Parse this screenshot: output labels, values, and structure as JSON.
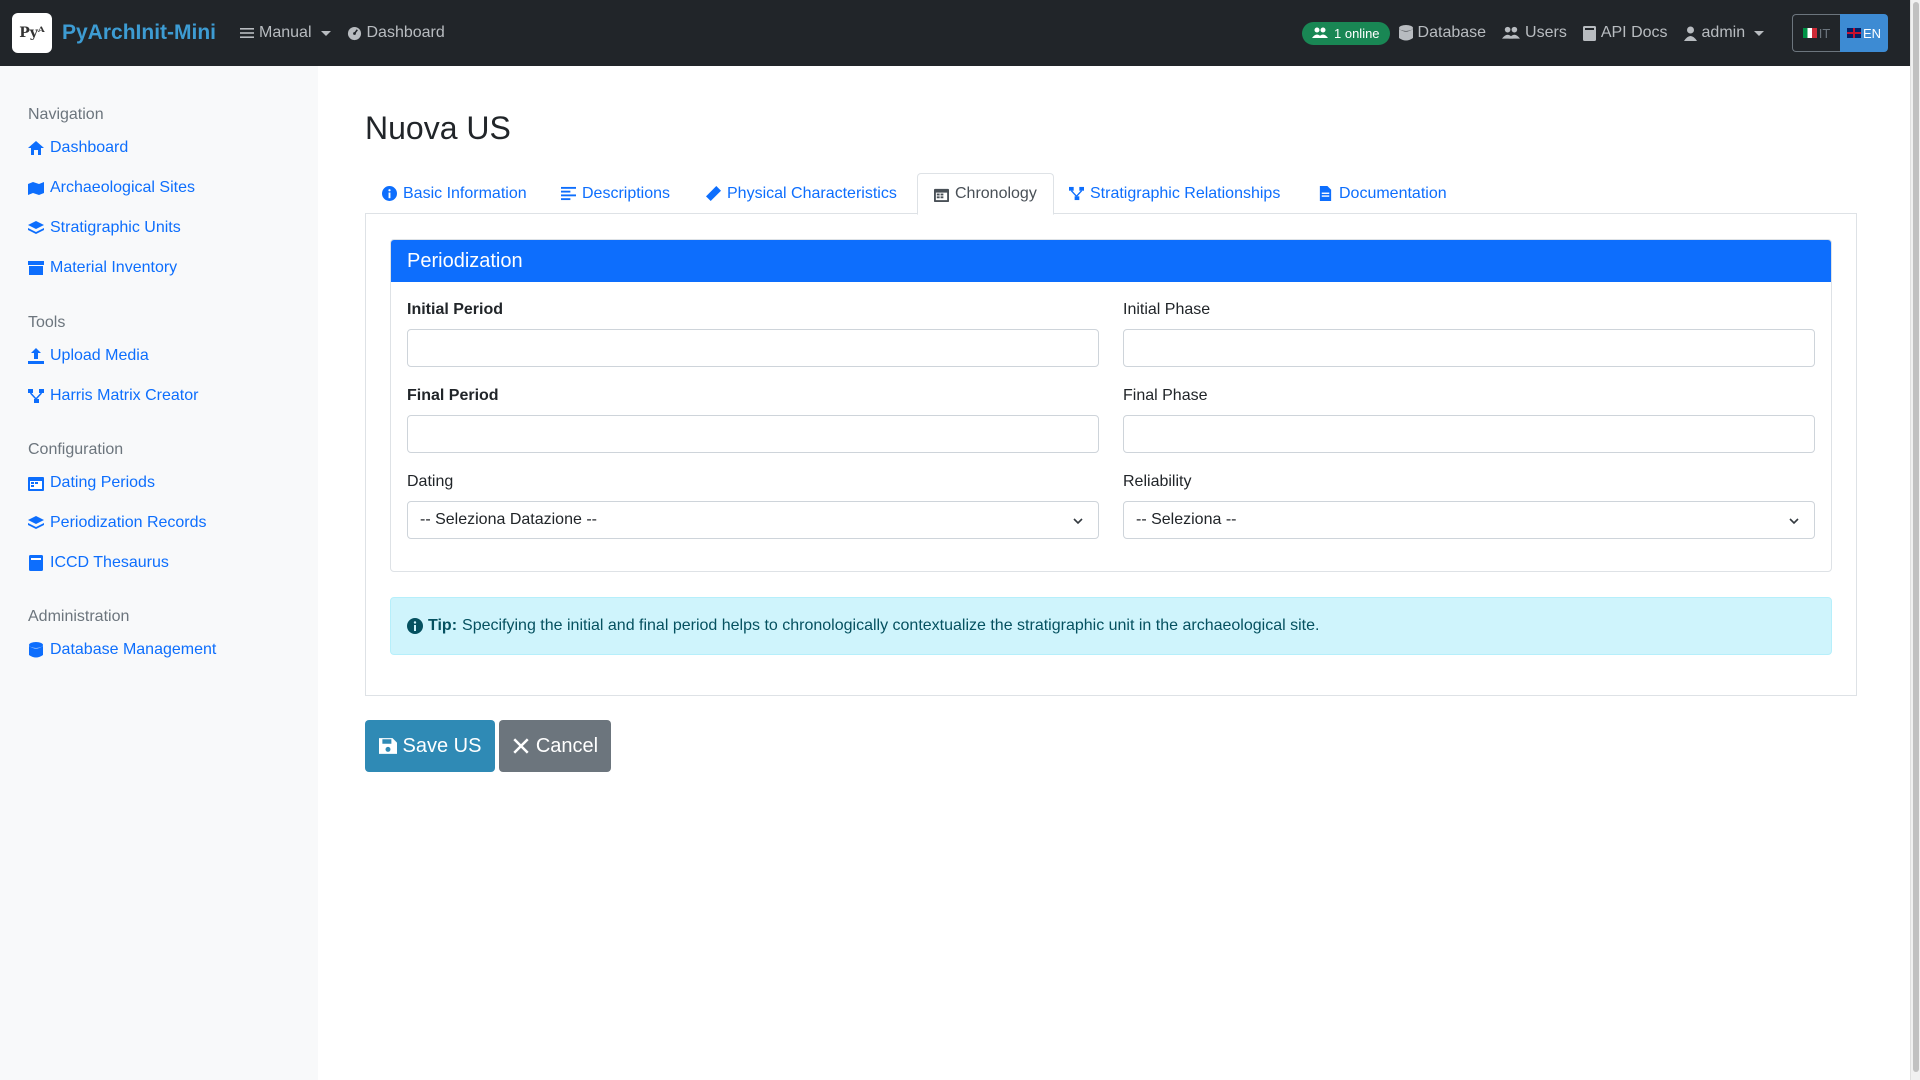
{
  "navbar": {
    "brand_logo_text": "Pyᴬ",
    "brand": "PyArchInit-Mini",
    "manual": "Manual",
    "dashboard": "Dashboard",
    "online": "1 online",
    "database": "Database",
    "users": "Users",
    "api_docs": "API Docs",
    "admin": "admin",
    "lang_it": "IT",
    "lang_en": "EN"
  },
  "sidebar": {
    "navigation_heading": "Navigation",
    "navigation": [
      {
        "label": "Dashboard",
        "icon": "home-icon"
      },
      {
        "label": "Archaeological Sites",
        "icon": "map-icon"
      },
      {
        "label": "Stratigraphic Units",
        "icon": "layers-icon"
      },
      {
        "label": "Material Inventory",
        "icon": "archive-icon"
      }
    ],
    "tools_heading": "Tools",
    "tools": [
      {
        "label": "Upload Media",
        "icon": "upload-icon"
      },
      {
        "label": "Harris Matrix Creator",
        "icon": "diagram-icon"
      }
    ],
    "configuration_heading": "Configuration",
    "configuration": [
      {
        "label": "Dating Periods",
        "icon": "calendar-icon"
      },
      {
        "label": "Periodization Records",
        "icon": "layers-icon"
      },
      {
        "label": "ICCD Thesaurus",
        "icon": "book-icon"
      }
    ],
    "administration_heading": "Administration",
    "administration": [
      {
        "label": "Database Management",
        "icon": "database-icon"
      }
    ]
  },
  "page": {
    "title": "Nuova US"
  },
  "tabs": [
    {
      "label": "Basic Information",
      "icon": "info-icon"
    },
    {
      "label": "Descriptions",
      "icon": "align-left-icon"
    },
    {
      "label": "Physical Characteristics",
      "icon": "ruler-icon"
    },
    {
      "label": "Chronology",
      "icon": "calendar-icon",
      "active": true
    },
    {
      "label": "Stratigraphic Relationships",
      "icon": "diagram-icon"
    },
    {
      "label": "Documentation",
      "icon": "file-icon"
    }
  ],
  "periodization": {
    "header": "Periodization",
    "initial_period_label": "Initial Period",
    "initial_period_value": "",
    "initial_phase_label": "Initial Phase",
    "initial_phase_value": "",
    "final_period_label": "Final Period",
    "final_period_value": "",
    "final_phase_label": "Final Phase",
    "final_phase_value": "",
    "dating_label": "Dating",
    "dating_selected": "-- Seleziona Datazione --",
    "reliability_label": "Reliability",
    "reliability_selected": "-- Seleziona --"
  },
  "tip": {
    "label": "Tip:",
    "text": "Specifying the initial and final period helps to chronologically contextualize the stratigraphic unit in the archaeological site."
  },
  "actions": {
    "save": "Save US",
    "cancel": "Cancel"
  },
  "colors": {
    "primary": "#0d6efd",
    "navbar": "#212529",
    "success": "#198754",
    "info_bg": "#cff4fc"
  }
}
